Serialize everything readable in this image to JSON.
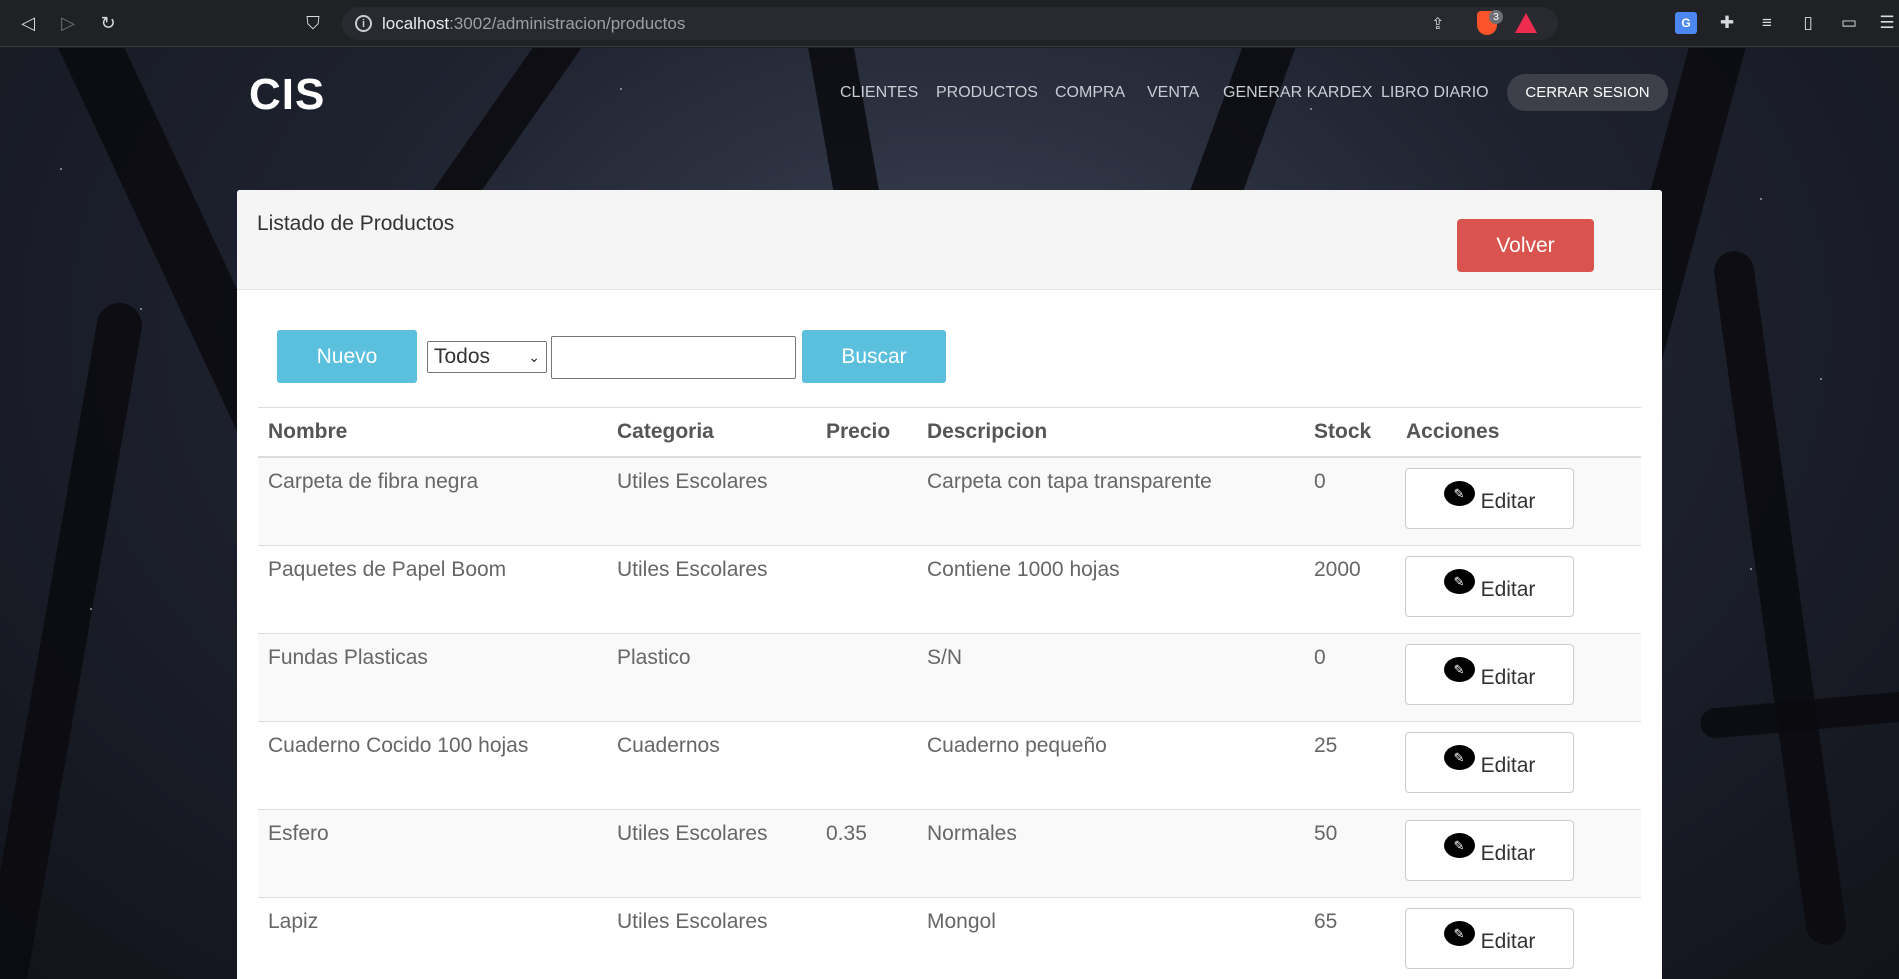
{
  "browser": {
    "url_host": "localhost",
    "url_rest": ":3002/administracion/productos",
    "brave_badge": "3"
  },
  "site": {
    "brand": "CIS",
    "nav": [
      "CLIENTES",
      "PRODUCTOS",
      "COMPRA",
      "VENTA",
      "GENERAR KARDEX",
      "LIBRO DIARIO"
    ],
    "logout_label": "CERRAR SESION"
  },
  "panel": {
    "title": "Listado de Productos",
    "back_label": "Volver"
  },
  "toolbar": {
    "new_label": "Nuevo",
    "filter_value": "Todos",
    "search_value": "",
    "search_label": "Buscar"
  },
  "table": {
    "columns": [
      "Nombre",
      "Categoria",
      "Precio",
      "Descripcion",
      "Stock",
      "Acciones"
    ],
    "edit_label": "Editar",
    "rows": [
      {
        "nombre": "Carpeta de fibra negra",
        "categoria": "Utiles Escolares",
        "precio": "",
        "descripcion": "Carpeta con tapa transparente",
        "stock": "0"
      },
      {
        "nombre": "Paquetes de Papel Boom",
        "categoria": "Utiles Escolares",
        "precio": "",
        "descripcion": "Contiene 1000 hojas",
        "stock": "2000"
      },
      {
        "nombre": "Fundas Plasticas",
        "categoria": "Plastico",
        "precio": "",
        "descripcion": "S/N",
        "stock": "0"
      },
      {
        "nombre": "Cuaderno Cocido 100 hojas",
        "categoria": "Cuadernos",
        "precio": "",
        "descripcion": "Cuaderno pequeño",
        "stock": "25"
      },
      {
        "nombre": "Esfero",
        "categoria": "Utiles Escolares",
        "precio": "0.35",
        "descripcion": "Normales",
        "stock": "50"
      },
      {
        "nombre": "Lapiz",
        "categoria": "Utiles Escolares",
        "precio": "",
        "descripcion": "Mongol",
        "stock": "65"
      }
    ]
  },
  "colors": {
    "primary_button": "#5bc0de",
    "danger_button": "#d9534f"
  }
}
